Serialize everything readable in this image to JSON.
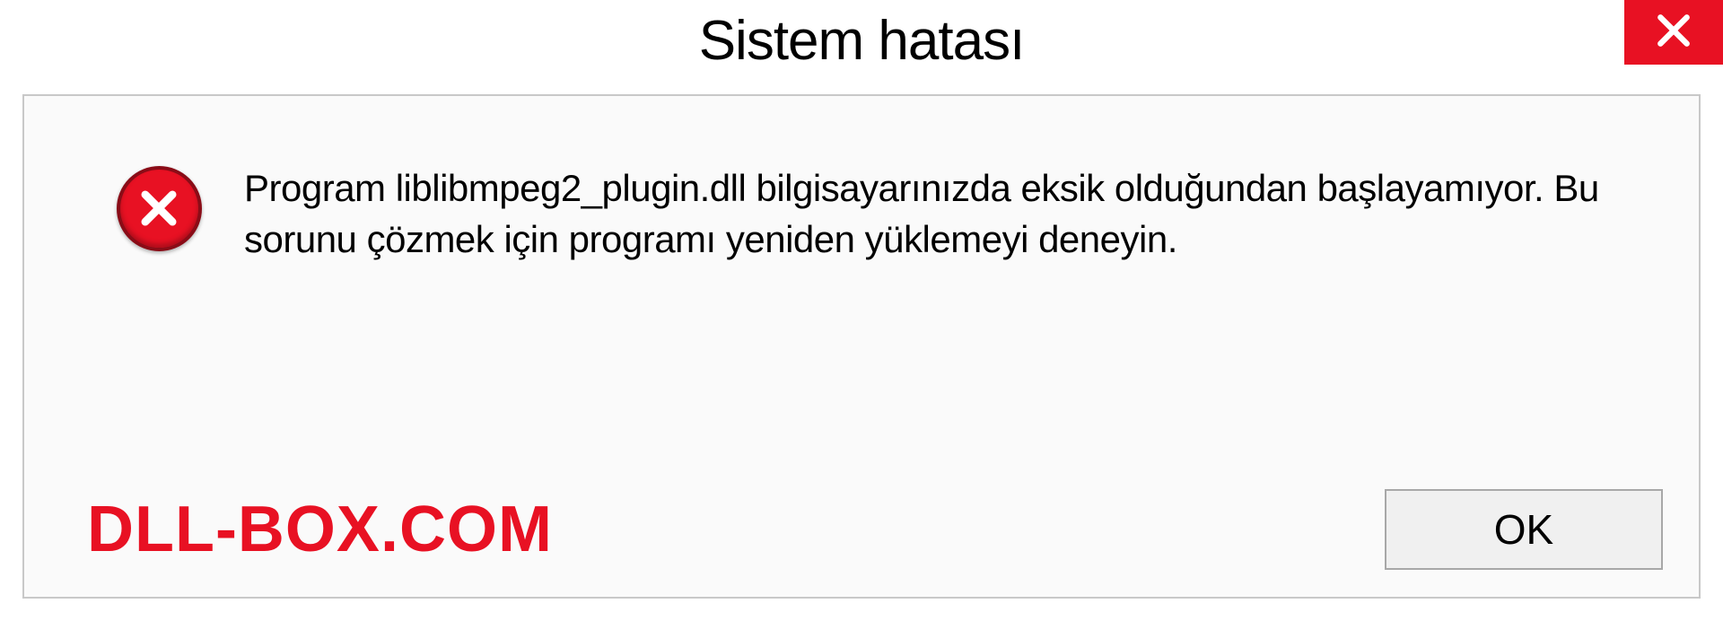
{
  "dialog": {
    "title": "Sistem hatası",
    "message": "Program liblibmpeg2_plugin.dll bilgisayarınızda eksik olduğundan başlayamıyor. Bu sorunu çözmek için programı yeniden yüklemeyi deneyin.",
    "ok_label": "OK"
  },
  "watermark": {
    "text": "DLL-BOX.COM"
  },
  "colors": {
    "error_red": "#e81123",
    "border_gray": "#c8c8c8"
  }
}
